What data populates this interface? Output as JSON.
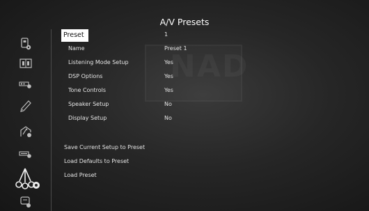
{
  "title": "A/V Presets",
  "sidebar": {
    "items": [
      {
        "icon": "source-settings-icon"
      },
      {
        "icon": "speaker-layout-icon"
      },
      {
        "icon": "input-settings-icon"
      },
      {
        "icon": "tone-pen-icon"
      },
      {
        "icon": "zone-settings-icon"
      },
      {
        "icon": "display-settings-icon"
      },
      {
        "icon": "av-presets-icon",
        "active": true
      },
      {
        "icon": "general-settings-icon"
      }
    ]
  },
  "settings": [
    {
      "label": "Preset",
      "value": "1",
      "selected": true
    },
    {
      "label": "Name",
      "value": "Preset 1"
    },
    {
      "label": "Listening Mode Setup",
      "value": "Yes"
    },
    {
      "label": "DSP Options",
      "value": "Yes"
    },
    {
      "label": "Tone Controls",
      "value": "Yes"
    },
    {
      "label": "Speaker Setup",
      "value": "No"
    },
    {
      "label": "Display Setup",
      "value": "No"
    }
  ],
  "actions": [
    {
      "label": "Save Current Setup to Preset"
    },
    {
      "label": "Load Defaults to Preset"
    },
    {
      "label": "Load Preset"
    }
  ],
  "watermark": "NAD"
}
